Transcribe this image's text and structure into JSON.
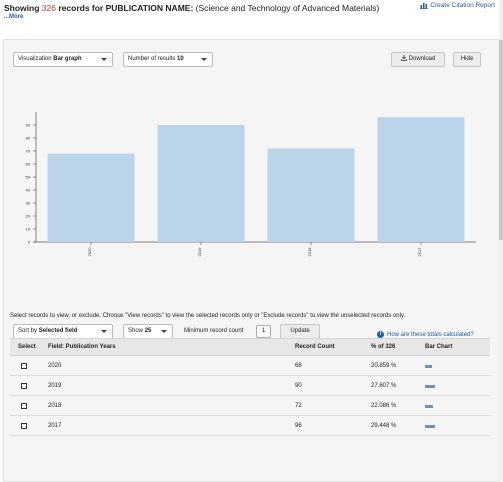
{
  "header": {
    "showing": "Showing",
    "count": "326",
    "records_for": "records for",
    "field_name": "PUBLICATION NAME:",
    "query": "(Science and Technology of Advanced Materials)",
    "more": "...More",
    "citation_report": "Create Citation Report"
  },
  "controls": {
    "visualization_label": "Visualization",
    "visualization_value": "Bar graph",
    "results_label": "Number of results",
    "results_value": "10",
    "download": "Download",
    "hide": "Hide"
  },
  "chart_data": {
    "type": "bar",
    "categories": [
      "2020",
      "2019",
      "2018",
      "2017"
    ],
    "values": [
      68,
      90,
      72,
      96
    ],
    "ylim": [
      0,
      100
    ],
    "yticks": [
      "0",
      "10",
      "20",
      "30",
      "40",
      "50",
      "60",
      "70",
      "80",
      "90"
    ],
    "bar_color": "#bcd4ea",
    "title": "",
    "xlabel": "",
    "ylabel": ""
  },
  "filters": {
    "sort_label": "Sort by",
    "sort_value": "Selected field",
    "show_label": "Show",
    "show_value": "25",
    "min_count_label": "Minimum record count",
    "min_count_value": "1",
    "update": "Update",
    "help": "How are these totals calculated?"
  },
  "instructions": "Select records to view, or exclude. Choose \"View records\" to view the selected records only or \"Exclude records\" to view the unselected records only.",
  "table": {
    "headers": {
      "select": "Select",
      "field": "Field: Publication Years",
      "record_count": "Record Count",
      "percent": "% of 326",
      "bar_chart": "Bar Chart"
    },
    "rows": [
      {
        "year": "2020",
        "count": "68",
        "percent": "20.859 %",
        "fraction": 0.209
      },
      {
        "year": "2019",
        "count": "90",
        "percent": "27.607 %",
        "fraction": 0.276
      },
      {
        "year": "2018",
        "count": "72",
        "percent": "22.086 %",
        "fraction": 0.221
      },
      {
        "year": "2017",
        "count": "96",
        "percent": "29.448 %",
        "fraction": 0.294
      }
    ]
  }
}
